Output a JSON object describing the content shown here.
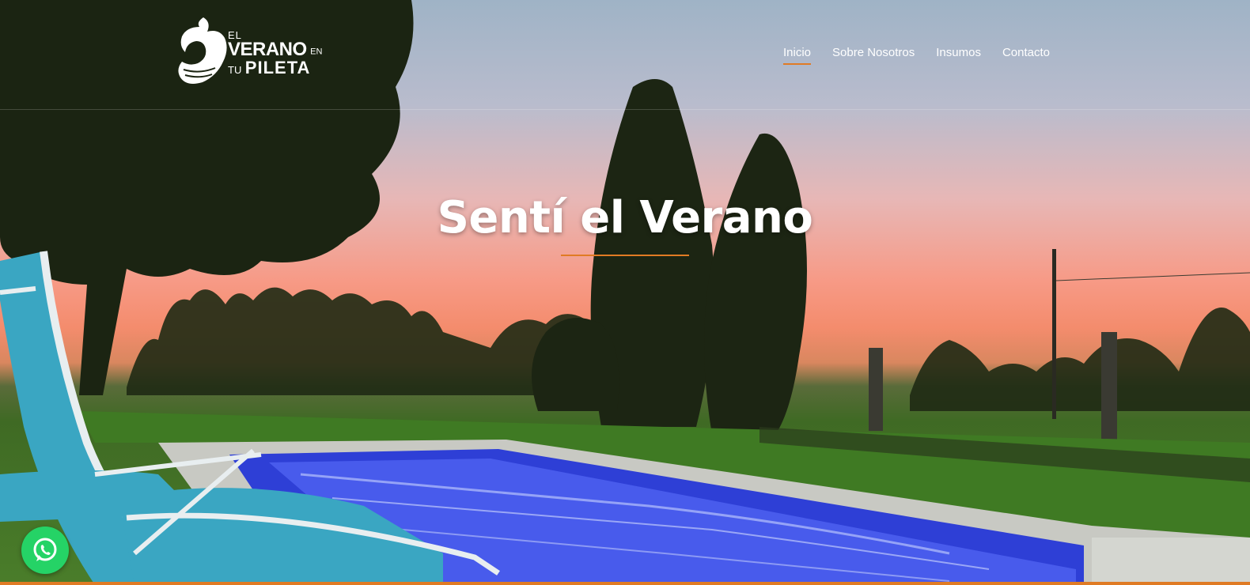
{
  "brand": {
    "logo_line1": "EL",
    "logo_line2": "VERANO",
    "logo_line2_small": "EN",
    "logo_line3_small": "TU",
    "logo_line3": "PILETA"
  },
  "nav": {
    "items": [
      {
        "label": "Inicio",
        "active": true
      },
      {
        "label": "Sobre Nosotros",
        "active": false
      },
      {
        "label": "Insumos",
        "active": false
      },
      {
        "label": "Contacto",
        "active": false
      }
    ]
  },
  "hero": {
    "title": "Sentí el Verano"
  },
  "colors": {
    "accent": "#e07b24",
    "whatsapp": "#25d366"
  },
  "icons": {
    "whatsapp": "whatsapp-icon"
  }
}
